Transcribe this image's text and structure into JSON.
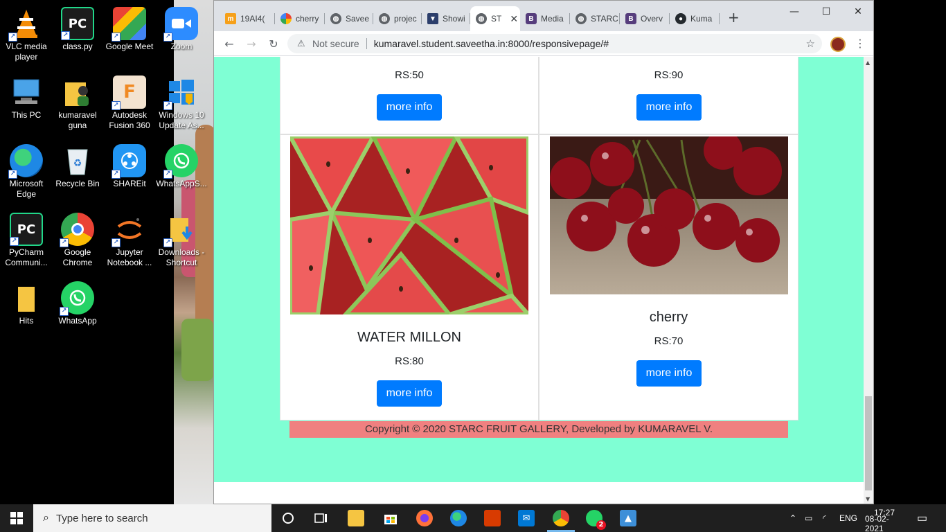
{
  "desktop": {
    "icons": [
      {
        "label": "VLC media player"
      },
      {
        "label": "class.py"
      },
      {
        "label": "Google Meet"
      },
      {
        "label": "Zoom"
      },
      {
        "label": "This PC"
      },
      {
        "label": "kumaravel guna"
      },
      {
        "label": "Autodesk Fusion 360"
      },
      {
        "label": "Windows 10 Update As..."
      },
      {
        "label": "Microsoft Edge"
      },
      {
        "label": "Recycle Bin"
      },
      {
        "label": "SHAREit"
      },
      {
        "label": "WhatsAppS..."
      },
      {
        "label": "PyCharm Communi..."
      },
      {
        "label": "Google Chrome"
      },
      {
        "label": "Jupyter Notebook ..."
      },
      {
        "label": "Downloads - Shortcut"
      },
      {
        "label": "Hits"
      },
      {
        "label": "WhatsApp"
      }
    ]
  },
  "browser": {
    "tabs": [
      {
        "label": "19AI4("
      },
      {
        "label": "cherry"
      },
      {
        "label": "Savee"
      },
      {
        "label": "projec"
      },
      {
        "label": "Showi"
      },
      {
        "label": "ST",
        "active": true
      },
      {
        "label": "Media"
      },
      {
        "label": "STARC"
      },
      {
        "label": "Overv"
      },
      {
        "label": "Kuma"
      }
    ],
    "address": {
      "security": "Not secure",
      "url": "kumaravel.student.saveetha.in:8000/responsivepage/#"
    }
  },
  "page": {
    "cards_top": [
      {
        "price": "RS:50",
        "button": "more info"
      },
      {
        "price": "RS:90",
        "button": "more info"
      }
    ],
    "cards": [
      {
        "title": "WATER MILLON",
        "price": "RS:80",
        "button": "more info",
        "image": "watermelon-slices"
      },
      {
        "title": "cherry",
        "price": "RS:70",
        "button": "more info",
        "image": "cherries"
      }
    ],
    "footer": "Copyright © 2020 STARC FRUIT GALLERY, Developed by KUMARAVEL V.",
    "background_color": "#7fffd4",
    "button_color": "#007bff",
    "footer_color": "#f08080"
  },
  "taskbar": {
    "search_placeholder": "Type here to search",
    "language": "ENG",
    "time": "17:27",
    "date": "08-02-2021",
    "whatsapp_badge": "2"
  }
}
